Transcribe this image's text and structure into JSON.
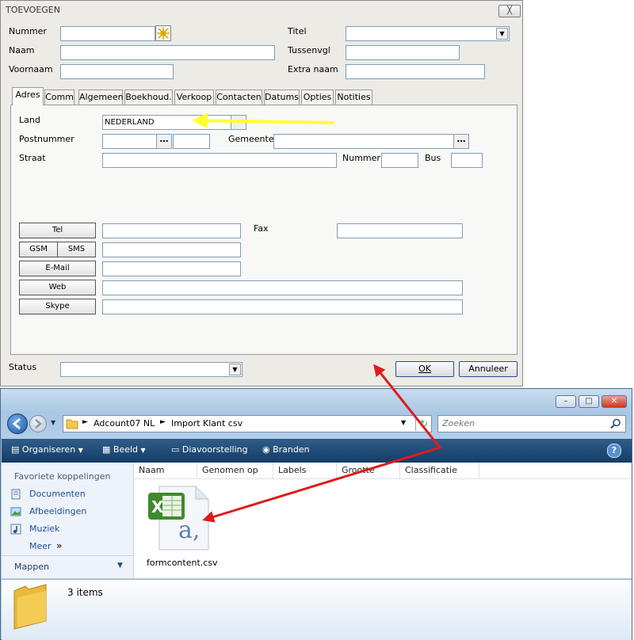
{
  "dialog": {
    "title": "TOEVOEGEN",
    "close_glyph": "╳",
    "labels": {
      "nummer": "Nummer",
      "naam": "Naam",
      "voornaam": "Voornaam",
      "titel": "Titel",
      "tussenvgl": "Tussenvgl",
      "extra_naam": "Extra naam",
      "status": "Status"
    },
    "tabs": [
      "Adres",
      "Comm",
      "Algemeen",
      "Boekhoud.",
      "Verkoop",
      "Contacten",
      "Datums",
      "Opties",
      "Notities"
    ],
    "adres": {
      "land_label": "Land",
      "land_value": "NEDERLAND",
      "postnummer_label": "Postnummer",
      "gemeente_label": "Gemeente",
      "straat_label": "Straat",
      "nummer_label": "Nummer",
      "bus_label": "Bus",
      "fax_label": "Fax"
    },
    "comm_buttons": {
      "tel": "Tel",
      "gsm": "GSM",
      "sms": "SMS",
      "email": "E-Mail",
      "web": "Web",
      "skype": "Skype"
    },
    "ok_label": "OK",
    "cancel_label": "Annuleer"
  },
  "explorer": {
    "window_buttons": {
      "minimize": "–",
      "maximize": "□",
      "close": "✕"
    },
    "breadcrumb": [
      "Adcount07 NL",
      "Import Klant csv"
    ],
    "search_placeholder": "Zoeken",
    "toolbar": [
      "Organiseren",
      "Beeld",
      "Diavoorstelling",
      "Branden"
    ],
    "favorites_heading": "Favoriete koppelingen",
    "favorites": [
      "Documenten",
      "Afbeeldingen",
      "Muziek"
    ],
    "more_label": "Meer",
    "more_glyph": "»",
    "folders_label": "Mappen",
    "columns": [
      "Naam",
      "Genomen op",
      "Labels",
      "Grootte",
      "Classificatie"
    ],
    "file": {
      "name": "formcontent.csv",
      "icon_letter": "a,"
    },
    "status": "3 items"
  },
  "colors": {
    "arrow_red": "#e01b1b",
    "arrow_yellow": "#ffff33",
    "accent": "#1e4e9a"
  }
}
